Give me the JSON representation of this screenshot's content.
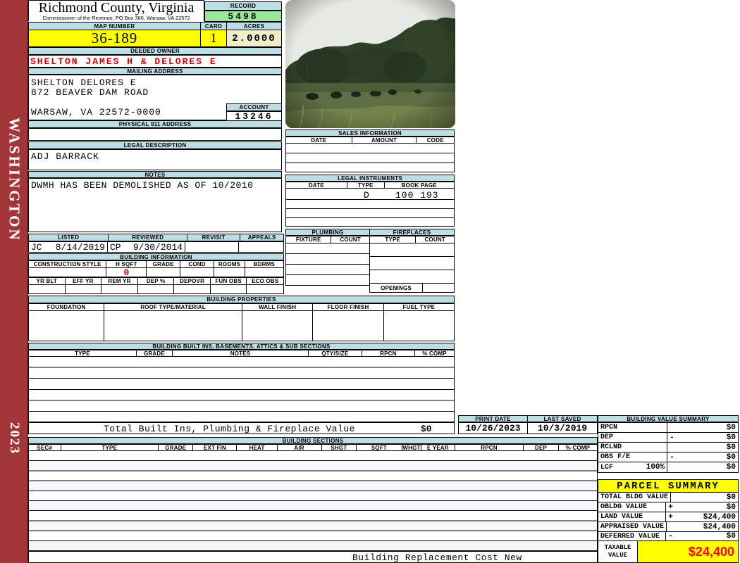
{
  "sidebar": {
    "county": "WASHINGTON",
    "year": "2023"
  },
  "header": {
    "title": "Richmond County, Virginia",
    "subtitle": "Commissioner of the Revenue, PO Box 366, Warsaw, VA 22572",
    "record_label": "RECORD",
    "record_value": "5498",
    "map_number_label": "MAP NUMBER",
    "map_number": "36-189",
    "card_label": "CARD",
    "card_value": "1",
    "acres_label": "ACRES",
    "acres_value": "2.0000"
  },
  "owner": {
    "label": "DEEDED OWNER",
    "name": "SHELTON JAMES H & DELORES E"
  },
  "mailing": {
    "label": "MAILING ADDRESS",
    "line1": "SHELTON DELORES E",
    "line2": "872 BEAVER DAM ROAD",
    "line3": "WARSAW, VA 22572-0000",
    "account_label": "ACCOUNT",
    "account_value": "13246"
  },
  "physical": {
    "label": "PHYSICAL 911 ADDRESS",
    "value": ""
  },
  "legal": {
    "label": "LEGAL DESCRIPTION",
    "value": "ADJ BARRACK"
  },
  "notes": {
    "label": "NOTES",
    "value": "DWMH HAS BEEN DEMOLISHED AS OF 10/2010"
  },
  "review": {
    "listed_label": "LISTED",
    "reviewed_label": "REVIEWED",
    "revisit_label": "REVISIT",
    "appeals_label": "APPEALS",
    "listed_by": "JC",
    "listed_date": "8/14/2019",
    "reviewed_by": "CP",
    "reviewed_date": "9/30/2014",
    "revisit_value": "",
    "appeals_value": ""
  },
  "building_info": {
    "title": "BUILDING INFORMATION",
    "cols_row1": [
      "CONSTRUCTION STYLE",
      "H SQFT",
      "GRADE",
      "COND",
      "ROOMS",
      "BDRMS"
    ],
    "h_sqft_value": "0",
    "cols_row2": [
      "YR BLT",
      "EFF YR",
      "REM YR",
      "DEP %",
      "DEPOVR",
      "FUN OBS",
      "ECO OBS"
    ]
  },
  "building_properties": {
    "title": "BUILDING PROPERTIES",
    "cols": [
      "FOUNDATION",
      "ROOF TYPE/MATERIAL",
      "WALL FINISH",
      "FLOOR FINISH",
      "FUEL TYPE"
    ]
  },
  "built_ins": {
    "title": "BUILDING BUILT INS, BASEMENTS, ATTICS & SUB SECTIONS",
    "cols": [
      "TYPE",
      "GRADE",
      "NOTES",
      "QTY/SIZE",
      "RPCN",
      "% COMP"
    ],
    "total_label": "Total Built Ins, Plumbing & Fireplace Value",
    "total_value": "$0"
  },
  "sales": {
    "title": "SALES INFORMATION",
    "cols": [
      "DATE",
      "AMOUNT",
      "CODE"
    ]
  },
  "instruments": {
    "title": "LEGAL INSTRUMENTS",
    "cols": [
      "DATE",
      "TYPE",
      "BOOK PAGE"
    ],
    "row1": {
      "date": "",
      "type": "D",
      "bookpage": "100 193"
    }
  },
  "plumbing": {
    "title": "PLUMBING",
    "cols": [
      "FIXTURE",
      "COUNT"
    ]
  },
  "fireplaces": {
    "title": "FIREPLACES",
    "cols": [
      "TYPE",
      "COUNT"
    ],
    "openings_label": "OPENINGS",
    "openings_value": ""
  },
  "print_info": {
    "print_date_label": "PRINT DATE",
    "print_date": "10/26/2023",
    "last_saved_label": "LAST SAVED",
    "last_saved": "10/3/2019"
  },
  "building_value_summary": {
    "title": "BUILDING VALUE SUMMARY",
    "rows": [
      {
        "label": "RPCN",
        "pct": "",
        "op": "",
        "value": "$0"
      },
      {
        "label": "DEP",
        "pct": "",
        "op": "-",
        "value": "$0"
      },
      {
        "label": "RCLND",
        "pct": "",
        "op": "",
        "value": "$0"
      },
      {
        "label": "OBS F/E",
        "pct": "",
        "op": "-",
        "value": "$0"
      },
      {
        "label": "LCF",
        "pct": "100%",
        "op": "",
        "value": "$0"
      }
    ]
  },
  "building_sections": {
    "title": "BUILDING SECTIONS",
    "cols": [
      "SEC#",
      "TYPE",
      "GRADE",
      "EXT FIN",
      "HEAT",
      "AIR",
      "SHGT",
      "SQFT",
      "WHGT",
      "E YEAR",
      "RPCN",
      "DEP",
      "% COMP"
    ]
  },
  "parcel_summary": {
    "title": "PARCEL SUMMARY",
    "rows": [
      {
        "label": "TOTAL BLDG VALUE",
        "op": "",
        "value": "$0"
      },
      {
        "label": "OBLDG VALUE",
        "op": "+",
        "value": "$0"
      },
      {
        "label": "LAND VALUE",
        "op": "+",
        "value": "$24,400"
      },
      {
        "label": "APPRAISED VALUE",
        "op": "",
        "value": "$24,400"
      },
      {
        "label": "DEFERRED VALUE",
        "op": "-",
        "value": "$0"
      }
    ],
    "taxable_label": "TAXABLE VALUE",
    "taxable_value": "$24,400"
  },
  "footer": {
    "text": "Building Replacement Cost New"
  },
  "colors": {
    "sidebar_red": "#A23538",
    "header_blue": "#BCDDE6",
    "record_green": "#99E79B",
    "highlight_yellow": "#FFFF00",
    "acres_cream": "#F0EDC8",
    "owner_red": "#CC0000",
    "taxable_red": "#FF0000"
  }
}
